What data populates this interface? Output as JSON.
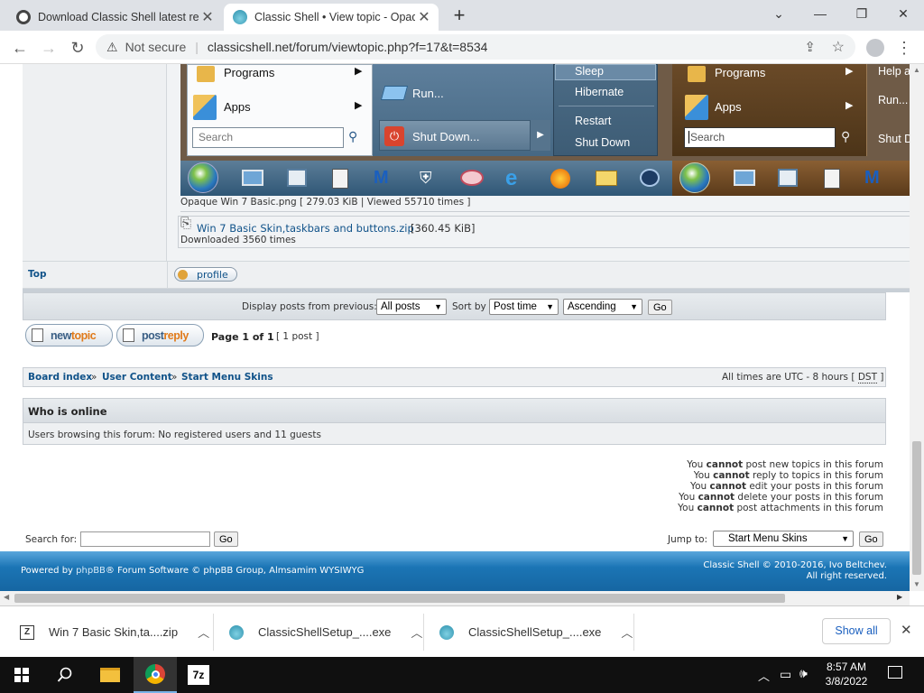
{
  "browser": {
    "tabs": [
      {
        "title": "Download Classic Shell latest rele",
        "favicon_color": "#444444",
        "active": false
      },
      {
        "title": "Classic Shell • View topic - Opaqu",
        "favicon_color": "#3aa8c1",
        "active": true
      }
    ],
    "not_secure_label": "Not secure",
    "url": "classicshell.net/forum/viewtopic.php?f=17&t=8534"
  },
  "startmenu": {
    "left": {
      "programs": "Programs",
      "apps": "Apps",
      "search_placeholder": "Search"
    },
    "middle": {
      "run": "Run...",
      "shutdown": "Shut Down...",
      "sleep": "Sleep",
      "hibernate": "Hibernate",
      "restart": "Restart",
      "shut_down": "Shut Down"
    },
    "right": {
      "programs": "Programs",
      "apps": "Apps",
      "search_placeholder": "Search",
      "help": "Help a",
      "run": "Run...",
      "shut": "Shut D"
    }
  },
  "post": {
    "image_caption": "Opaque Win 7 Basic.png [ 279.03 KiB | Viewed 55710 times ]",
    "attachment_name": "Win 7 Basic Skin,taskbars and buttons.zip",
    "attachment_size": "[360.45 KiB]",
    "attachment_downloads": "Downloaded 3560 times",
    "top_link": "Top",
    "profile_button": "profile"
  },
  "display_options": {
    "label": "Display posts from previous:",
    "posts_value": "All posts",
    "sort_label": "Sort by",
    "sort_value": "Post time",
    "order_value": "Ascending",
    "go": "Go"
  },
  "actions": {
    "newtopic_a": "new",
    "newtopic_b": "topic",
    "postreply_a": "post",
    "postreply_b": "reply",
    "page_info": "Page 1 of 1",
    "post_count": "[ 1 post ]"
  },
  "breadcrumb": {
    "board_index": "Board index",
    "sep": "»",
    "user_content": "User Content",
    "start_menu_skins": "Start Menu Skins",
    "times_text": "All times are UTC - 8 hours [",
    "dst": "DST",
    "times_close": "]"
  },
  "who_online": {
    "heading": "Who is online",
    "text": "Users browsing this forum: No registered users and 11 guests"
  },
  "permissions": [
    {
      "pre": "You",
      "bold": "cannot",
      "post": "post new topics in this forum"
    },
    {
      "pre": "You",
      "bold": "cannot",
      "post": "reply to topics in this forum"
    },
    {
      "pre": "You",
      "bold": "cannot",
      "post": "edit your posts in this forum"
    },
    {
      "pre": "You",
      "bold": "cannot",
      "post": "delete your posts in this forum"
    },
    {
      "pre": "You",
      "bold": "cannot",
      "post": "post attachments in this forum"
    }
  ],
  "search": {
    "label": "Search for:",
    "go": "Go"
  },
  "jump": {
    "label": "Jump to:",
    "value": "Start Menu Skins",
    "go": "Go"
  },
  "footer": {
    "powered_pre": "Powered by",
    "phpbb_link": "phpBB",
    "powered_post": "® Forum Software © phpBB Group, Almsamim WYSIWYG",
    "copyright1": "Classic Shell © 2010-2016, Ivo Beltchev.",
    "copyright2": "All right reserved."
  },
  "downloads": [
    {
      "name": "Win 7 Basic Skin,ta....zip"
    },
    {
      "name": "ClassicShellSetup_....exe"
    },
    {
      "name": "ClassicShellSetup_....exe"
    }
  ],
  "downloads_show_all": "Show all",
  "system": {
    "time": "8:57 AM",
    "date": "3/8/2022",
    "app_7z": "7z"
  },
  "colors": {
    "phpbb_blue": "#105289",
    "footer_blue": "#1b75b5",
    "win7_taskbar": "#2a5577"
  }
}
